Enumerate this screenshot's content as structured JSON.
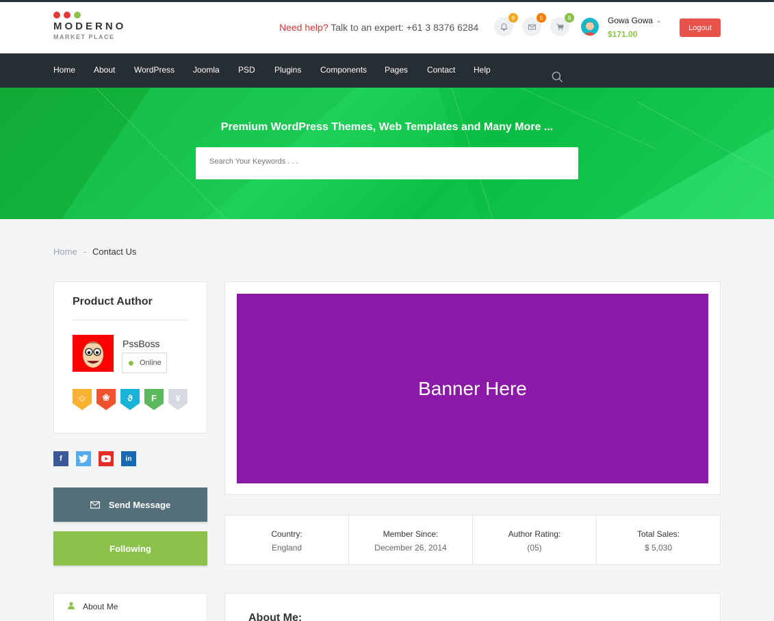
{
  "brand": {
    "name": "MODERNO",
    "tagline": "MARKET PLACE",
    "dot_colors": [
      "#e53935",
      "#e53935",
      "#8bc34a"
    ]
  },
  "header": {
    "help_prefix": "Need help?",
    "help_text": "Talk to an expert: +61 3 8376 6284",
    "notifications": {
      "icon": "bell-icon",
      "count": "8",
      "badge_color": "#f5a623"
    },
    "messages": {
      "icon": "mail-icon",
      "count": "5",
      "badge_color": "#f57c00"
    },
    "cart": {
      "icon": "cart-icon",
      "count": "8",
      "badge_color": "#8bc34a"
    },
    "user_name": "Gowa Gowa",
    "user_balance": "$171.00",
    "logout_label": "Logout"
  },
  "nav": {
    "items": [
      {
        "label": "Home"
      },
      {
        "label": "About"
      },
      {
        "label": "WordPress"
      },
      {
        "label": "Joomla"
      },
      {
        "label": "PSD"
      },
      {
        "label": "Plugins"
      },
      {
        "label": "Components"
      },
      {
        "label": "Pages"
      },
      {
        "label": "Contact"
      },
      {
        "label": "Help"
      }
    ]
  },
  "hero": {
    "title": "Premium WordPress Themes, Web Templates and Many More ...",
    "search_placeholder": "Search Your Keywords . . ."
  },
  "breadcrumb": {
    "home": "Home",
    "separator": "-",
    "current": "Contact Us"
  },
  "author_card": {
    "title": "Product Author",
    "name": "PssBoss",
    "status": "Online",
    "badges": [
      {
        "icon": "smile-icon",
        "color": "#f9b233"
      },
      {
        "icon": "leaf-icon",
        "color": "#f0522e"
      },
      {
        "icon": "bolt-icon",
        "color": "#1ab3d8"
      },
      {
        "icon": "foursquare-icon",
        "color": "#5cb85c"
      },
      {
        "icon": "yen-icon",
        "color": "#d5dbe0"
      }
    ]
  },
  "socials": [
    {
      "icon": "facebook-icon",
      "color": "#3b5998"
    },
    {
      "icon": "twitter-icon",
      "color": "#55acee"
    },
    {
      "icon": "youtube-icon",
      "color": "#e52d27"
    },
    {
      "icon": "linkedin-icon",
      "color": "#1769b5"
    }
  ],
  "actions": {
    "send_message": "Send Message",
    "following": "Following"
  },
  "banner": {
    "text": "Banner Here"
  },
  "stats": [
    {
      "label": "Country:",
      "value": "England"
    },
    {
      "label": "Member Since:",
      "value": "December 26, 2014"
    },
    {
      "label": "Author Rating:",
      "value": "(05)"
    },
    {
      "label": "Total Sales:",
      "value": "$ 5,030"
    }
  ],
  "about": {
    "tab_label": "About Me",
    "heading": "About Me:"
  }
}
